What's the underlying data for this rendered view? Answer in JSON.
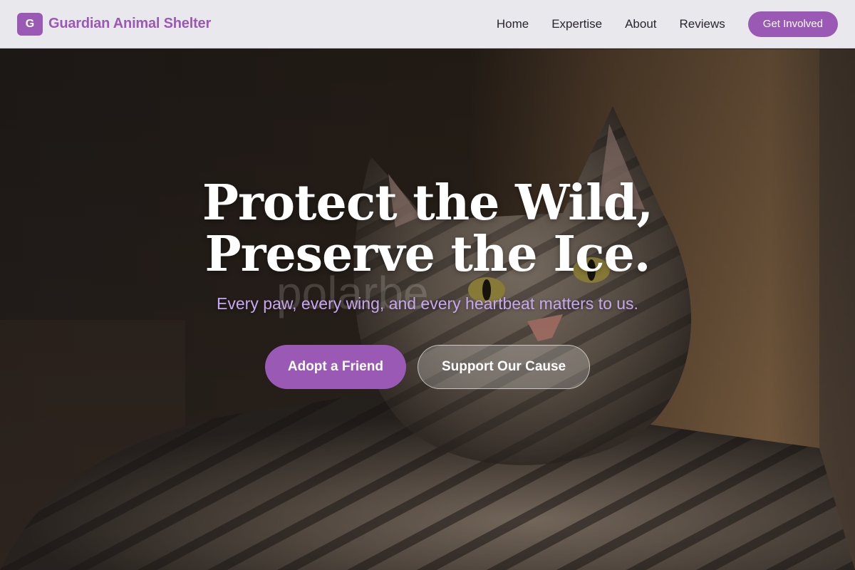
{
  "header": {
    "logo_letter": "G",
    "brand_name": "Guardian Animal Shelter",
    "nav": [
      "Home",
      "Expertise",
      "About",
      "Reviews"
    ],
    "cta_label": "Get Involved"
  },
  "hero": {
    "headline_line1": "Protect the Wild,",
    "headline_line2": "Preserve the Ice.",
    "subheadline": "Every paw, every wing, and every heartbeat matters to us.",
    "primary_button": "Adopt a Friend",
    "secondary_button": "Support Our Cause",
    "background_watermark": "polarbe"
  },
  "colors": {
    "accent": "#9b59b6",
    "header_bg": "#e9e8ec",
    "subheadline": "#c7a7ee"
  }
}
